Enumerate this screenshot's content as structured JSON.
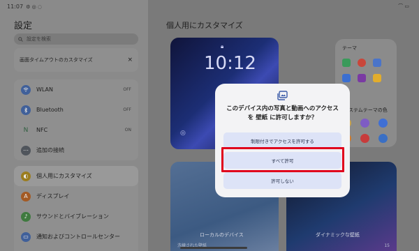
{
  "status_bar": {
    "time": "11:07"
  },
  "sidebar": {
    "title": "設定",
    "search_placeholder": "設定を検索",
    "tip": {
      "text": "画面タイムアウトのカスタマイズ",
      "close": "×"
    },
    "connection_items": [
      {
        "label": "WLAN",
        "state": "OFF",
        "icon": "wifi-icon",
        "color": "#2f6ad8"
      },
      {
        "label": "Bluetooth",
        "state": "OFF",
        "icon": "bluetooth-icon",
        "color": "#2f6ad8"
      },
      {
        "label": "NFC",
        "state": "ON",
        "icon": "nfc-icon",
        "color": "#3d8b5a"
      },
      {
        "label": "追加の接続",
        "state": "",
        "icon": "more-connections-icon",
        "color": "#5d6470"
      }
    ],
    "personal_items": [
      {
        "label": "個人用にカスタマイズ",
        "icon": "palette-icon",
        "color": "#c79a12",
        "active": true
      },
      {
        "label": "ディスプレイ",
        "icon": "display-icon",
        "color": "#d06a1a",
        "active": false
      },
      {
        "label": "サウンドとバイブレーション",
        "icon": "sound-icon",
        "color": "#3a8e3a",
        "active": false
      },
      {
        "label": "通知およびコントロールセンター",
        "icon": "notification-icon",
        "color": "#2f6ad8",
        "active": false
      }
    ]
  },
  "main": {
    "title": "個人用にカスタマイズ",
    "lockscreen_clock": "10:12",
    "theme_label": "テーマ",
    "system_theme_colors_label": "システムテーマの色",
    "bottom_left_caption": "ローカルのデバイス",
    "bottom_left_sub": "洗練された壁紙",
    "bottom_right_caption": "ダイナミックな壁紙",
    "bottom_right_sub": "15"
  },
  "dialog": {
    "message": "このデバイス内の写真と動画へのアクセスを 壁紙 に許可しますか？",
    "options": [
      "制限付きでアクセスを許可する",
      "すべて許可",
      "許可しない"
    ],
    "highlighted_option_index": 1
  },
  "colors": {
    "highlight": "#e0001c",
    "dialog_option_bg": "#dde3f7"
  }
}
